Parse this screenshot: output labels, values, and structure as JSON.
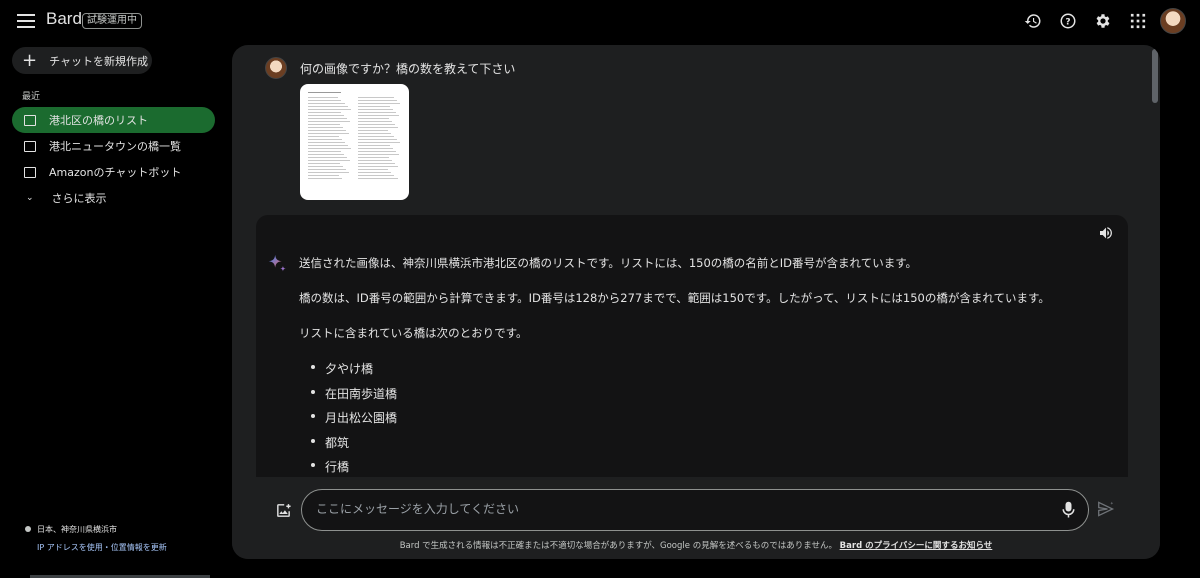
{
  "header": {
    "brand": "Bard",
    "badge": "試験運用中",
    "icons": [
      "history-icon",
      "help-icon",
      "settings-icon",
      "apps-icon",
      "avatar"
    ]
  },
  "sidebar": {
    "new_chat": "チャットを新規作成",
    "recent_label": "最近",
    "items": [
      {
        "label": "港北区の橋のリスト",
        "active": true
      },
      {
        "label": "港北ニュータウンの橋一覧",
        "active": false
      },
      {
        "label": "Amazonのチャットボット",
        "active": false
      }
    ],
    "show_more": "さらに表示",
    "location": "日本、神奈川県横浜市",
    "location_link": "IP アドレスを使用・位置情報を更新"
  },
  "conversation": {
    "user_prompt": "何の画像ですか？橋の数を教えて下さい",
    "response": {
      "paragraphs": [
        "送信された画像は、神奈川県横浜市港北区の橋のリストです。リストには、150の橋の名前とID番号が含まれています。",
        "橋の数は、ID番号の範囲から計算できます。ID番号は128から277までで、範囲は150です。したがって、リストには150の橋が含まれています。",
        "リストに含まれている橋は次のとおりです。"
      ],
      "bullets": [
        "夕やけ橋",
        "在田南歩道橋",
        "月出松公園橋",
        "都筑",
        "行橋"
      ]
    }
  },
  "composer": {
    "placeholder": "ここにメッセージを入力してください",
    "disclaimer": "Bard で生成される情報は不正確または不適切な場合がありますが、Google の見解を述べるものではありません。",
    "privacy_link": "Bard のプライバシーに関するお知らせ"
  },
  "colors": {
    "accent_active": "#1b6b2f",
    "panel": "#1e1f20",
    "response_bg": "#131314"
  }
}
